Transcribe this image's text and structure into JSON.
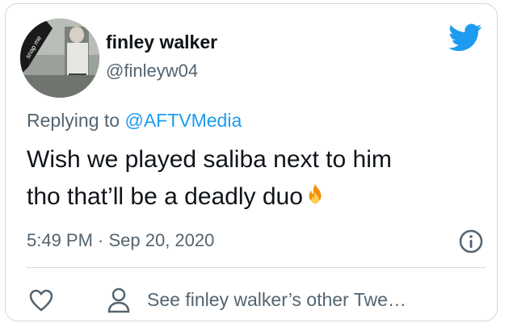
{
  "user": {
    "display_name": "finley walker",
    "handle": "@finleyw04",
    "avatar_overlay_text": "snap me"
  },
  "reply": {
    "prefix": "Replying to ",
    "mention": "@AFTVMedia"
  },
  "tweet": {
    "line1": "Wish we played saliba next to him",
    "line2": "tho that’ll be a deadly duo",
    "emoji": "fire-icon"
  },
  "meta": {
    "timestamp": "5:49 PM · Sep 20, 2020"
  },
  "actions": {
    "see_more_label": "See finley walker’s other Twe…"
  },
  "colors": {
    "brand_blue": "#1d9bf0",
    "text_primary": "#0f1419",
    "text_secondary": "#536471",
    "border": "#cfd9de"
  }
}
